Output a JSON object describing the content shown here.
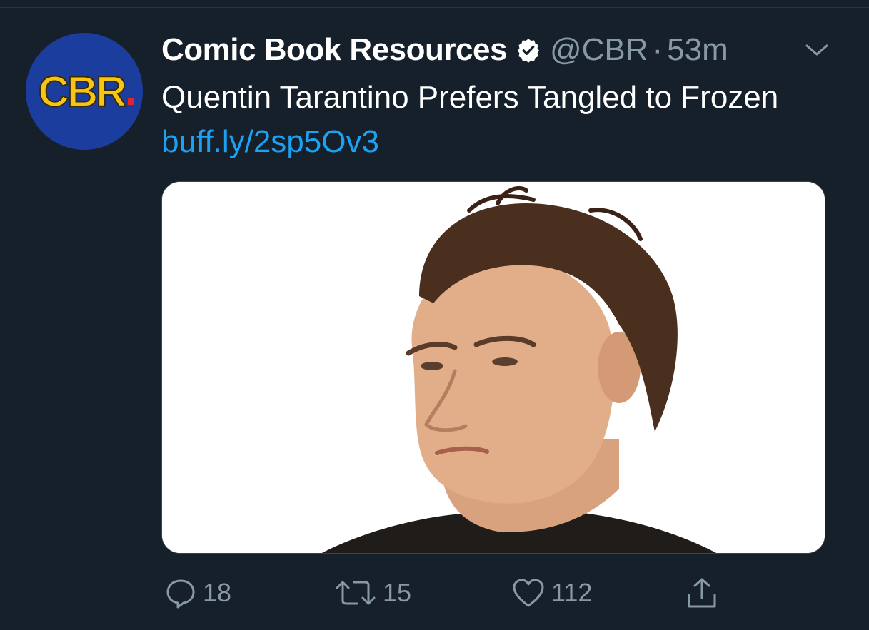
{
  "tweet": {
    "avatar_text": "CBR",
    "display_name": "Comic Book Resources",
    "verified": true,
    "handle": "@CBR",
    "separator": "·",
    "time": "53m",
    "text": "Quentin Tarantino Prefers Tangled to Frozen",
    "link": "buff.ly/2sp5Ov3"
  },
  "actions": {
    "replies": "18",
    "retweets": "15",
    "likes": "112"
  },
  "icons": {
    "reply": "reply-icon",
    "retweet": "retweet-icon",
    "like": "heart-icon",
    "share": "share-icon",
    "verified": "verified-badge-icon",
    "more": "chevron-down-icon"
  },
  "colors": {
    "background": "#15202b",
    "link": "#1da1f2",
    "secondary_text": "#8899a6",
    "avatar_bg": "#1a3d9e",
    "avatar_text": "#f5c518"
  }
}
